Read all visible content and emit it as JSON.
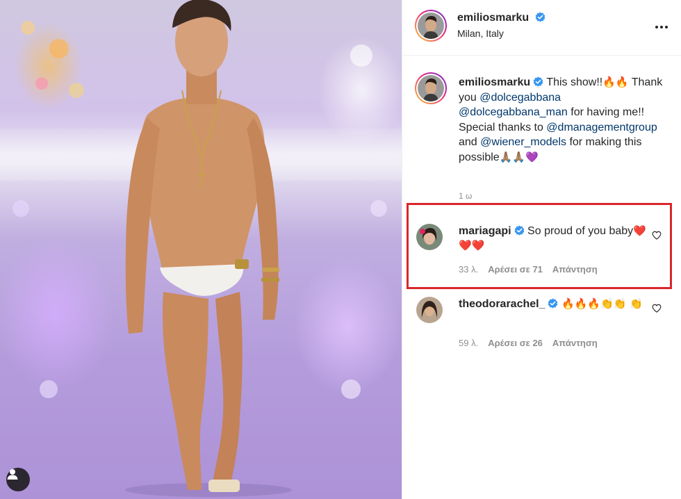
{
  "post": {
    "author": {
      "username": "emiliosmarku",
      "verified": true,
      "location": "Milan, Italy"
    },
    "caption": {
      "username": "emiliosmarku",
      "parts": [
        {
          "text": " This show!!",
          "type": "text"
        },
        {
          "text": "🔥🔥",
          "type": "emoji"
        },
        {
          "text": " Thank you ",
          "type": "text"
        },
        {
          "text": "@dolcegabbana",
          "type": "mention"
        },
        {
          "text": " ",
          "type": "text"
        },
        {
          "text": "@dolcegabbana_man",
          "type": "mention"
        },
        {
          "text": " for having me!! Special thanks to ",
          "type": "text"
        },
        {
          "text": "@dmanagementgroup",
          "type": "mention"
        },
        {
          "text": " and ",
          "type": "text"
        },
        {
          "text": "@wiener_models",
          "type": "mention"
        },
        {
          "text": " for making this possible",
          "type": "text"
        },
        {
          "text": "🙏🏽🙏🏽💜",
          "type": "emoji"
        }
      ],
      "time": "1 ω"
    },
    "comments": [
      {
        "username": "mariagapi",
        "verified": true,
        "text": "So proud of you baby",
        "emoji": "❤️❤️❤️",
        "time": "33 λ.",
        "likes": "Αρέσει σε 71",
        "reply": "Απάντηση",
        "highlighted": true
      },
      {
        "username": "theodorarachel_",
        "verified": true,
        "text": "",
        "emoji": "🔥🔥🔥👏👏 👏",
        "time": "59 λ.",
        "likes": "Αρέσει σε 26",
        "reply": "Απάντηση",
        "highlighted": false
      }
    ]
  },
  "icons": {
    "verified": "verified-badge-icon",
    "more": "more-options-icon",
    "heart": "heart-outline-icon",
    "user": "user-tag-icon"
  },
  "colors": {
    "verified": "#3897f0",
    "mention": "#00376b",
    "muted": "#8e8e8e",
    "highlight": "#d9262b"
  }
}
